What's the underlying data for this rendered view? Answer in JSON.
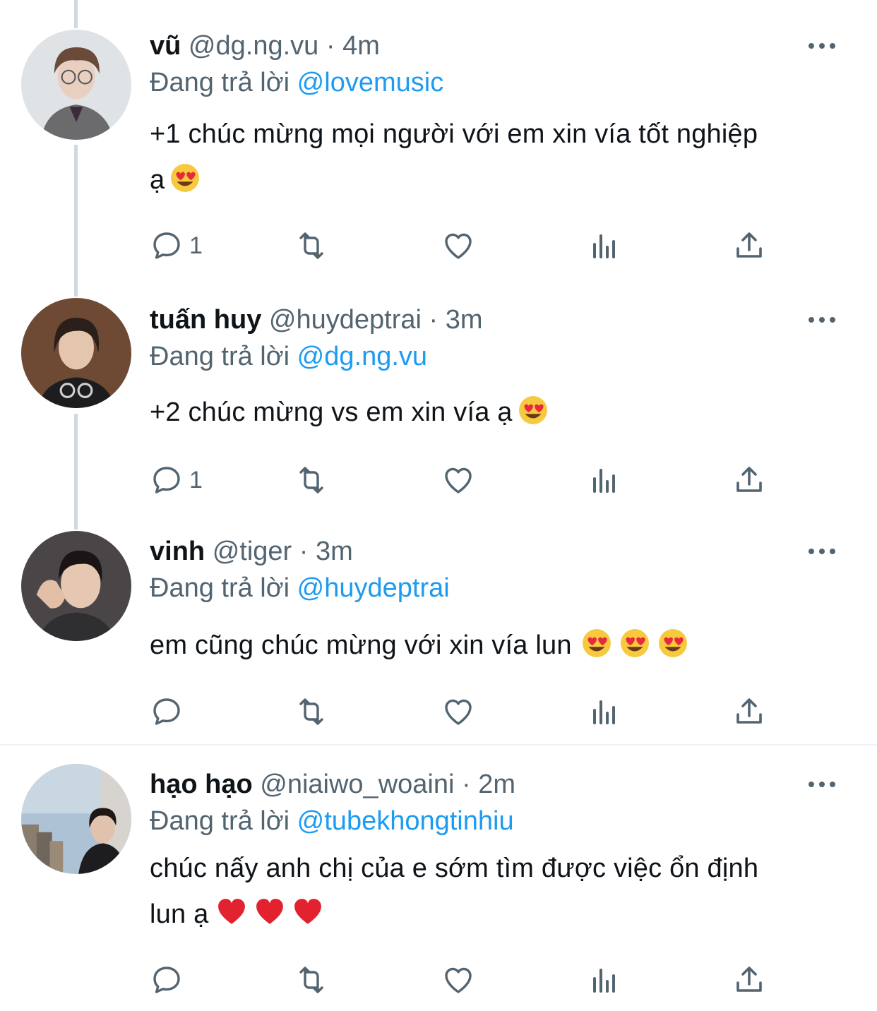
{
  "colors": {
    "link": "#1d9bf0",
    "secondary": "#536471",
    "text": "#0f1419",
    "thread_line": "#cfd9de",
    "divider": "#eff3f4"
  },
  "tweets": [
    {
      "name": "vũ",
      "handle": "@dg.ng.vu",
      "sep": "·",
      "time": "4m",
      "replying_label": "Đang trả lời",
      "replying_to": "@lovemusic",
      "text_line1": "+1 chúc mừng mọi người với em xin vía tốt nghiệp",
      "text_line2": "ạ",
      "emojis": [
        "heart-eyes"
      ],
      "reply_count": "1"
    },
    {
      "name": "tuấn huy",
      "handle": "@huydeptrai",
      "sep": "·",
      "time": "3m",
      "replying_label": "Đang trả lời",
      "replying_to": "@dg.ng.vu",
      "text_line1": "+2 chúc mừng vs em xin vía ạ",
      "emojis": [
        "heart-eyes"
      ],
      "reply_count": "1"
    },
    {
      "name": "vinh",
      "handle": "@tiger",
      "sep": "·",
      "time": "3m",
      "replying_label": "Đang trả lời",
      "replying_to": "@huydeptrai",
      "text_line1": "em cũng chúc mừng với xin vía lun",
      "emojis": [
        "heart-eyes",
        "heart-eyes",
        "heart-eyes"
      ],
      "reply_count": ""
    },
    {
      "name": "hạo hạo",
      "handle": "@niaiwo_woaini",
      "sep": "·",
      "time": "2m",
      "replying_label": "Đang trả lời",
      "replying_to": "@tubekhongtinhiu",
      "text_line1": "chúc nấy anh chị của e sớm tìm được việc ổn định",
      "text_line2": "lun ạ",
      "emojis": [
        "red-heart",
        "red-heart",
        "red-heart"
      ],
      "reply_count": ""
    }
  ]
}
